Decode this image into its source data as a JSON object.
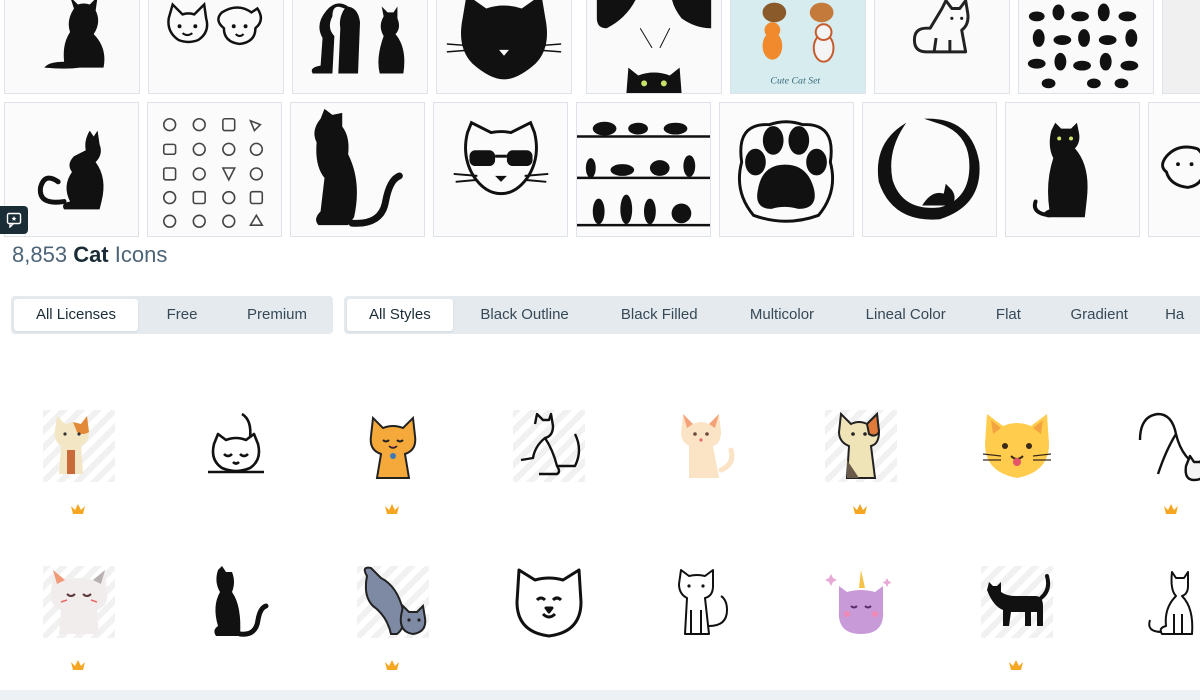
{
  "preview_strip": {
    "top_row": [
      {
        "icon": "cat-silhouette-sitting-icon"
      },
      {
        "icon": "cat-and-dog-faces-icon"
      },
      {
        "icon": "dog-and-cat-silhouette-icon"
      },
      {
        "icon": "black-cat-face-icon"
      },
      {
        "icon": "peeking-black-cats-icon"
      },
      {
        "icon": "cute-cat-set-illustration-icon",
        "caption": "Cute Cat Set"
      },
      {
        "icon": "cat-outline-sitting-icon"
      },
      {
        "icon": "cat-silhouettes-collection-icon"
      }
    ],
    "bottom_row": [
      {
        "icon": "cat-outline-sitting-side-icon"
      },
      {
        "icon": "cat-line-icon-set-icon"
      },
      {
        "icon": "tall-cat-silhouette-icon"
      },
      {
        "icon": "cat-with-sunglasses-icon"
      },
      {
        "icon": "cats-on-shelves-icon"
      },
      {
        "icon": "paw-print-icon"
      },
      {
        "icon": "cat-in-circle-logo-icon"
      },
      {
        "icon": "black-cat-sitting-icon"
      },
      {
        "icon": "dog-face-outline-icon"
      }
    ]
  },
  "results": {
    "count": "8,853",
    "keyword": "Cat",
    "suffix": "Icons"
  },
  "license_filter": {
    "options": [
      "All Licenses",
      "Free",
      "Premium"
    ],
    "selected": "All Licenses"
  },
  "style_filter": {
    "options": [
      "All Styles",
      "Black Outline",
      "Black Filled",
      "Multicolor",
      "Lineal Color",
      "Flat",
      "Gradient",
      "Ha"
    ],
    "selected": "All Styles"
  },
  "icon_grid": {
    "row1": [
      {
        "icon": "calico-cat-flat-icon",
        "premium": true
      },
      {
        "icon": "cat-stretching-outline-icon",
        "premium": false
      },
      {
        "icon": "orange-cat-lineal-color-icon",
        "premium": true
      },
      {
        "icon": "cat-playing-outline-icon",
        "premium": false
      },
      {
        "icon": "peach-cat-flat-icon",
        "premium": false
      },
      {
        "icon": "calico-cat-lineal-color-icon",
        "premium": true
      },
      {
        "icon": "yellow-cat-face-icon",
        "premium": false
      },
      {
        "icon": "cat-stretching-kitten-outline-icon",
        "premium": true
      }
    ],
    "row2": [
      {
        "icon": "white-kitten-flat-icon",
        "premium": true
      },
      {
        "icon": "black-cat-silhouette-icon",
        "premium": false
      },
      {
        "icon": "gray-cats-lineal-color-icon",
        "premium": true
      },
      {
        "icon": "cat-face-outline-icon",
        "premium": false
      },
      {
        "icon": "cat-sitting-outline-icon",
        "premium": false
      },
      {
        "icon": "unicorn-cat-icon",
        "premium": false
      },
      {
        "icon": "black-cat-walking-icon",
        "premium": true
      },
      {
        "icon": "cat-line-sitting-icon",
        "premium": false
      }
    ]
  },
  "colors": {
    "accent_premium": "#f5a623",
    "text_dark": "#1a2c36",
    "text_muted": "#4d6477",
    "filter_bg": "#e4eaee"
  }
}
